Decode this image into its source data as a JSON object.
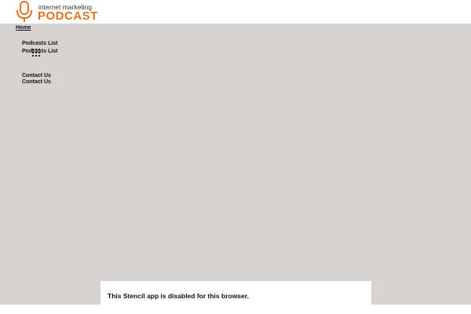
{
  "header": {
    "logo": {
      "line1": "internet marketing",
      "line2": "PODCAST",
      "icon": "microphone-icon",
      "brand_color": "#e0741f"
    }
  },
  "nav": {
    "home": "Home",
    "items": [
      {
        "label": "Podcasts List"
      },
      {
        "label": "Podcasts List"
      },
      {
        "label": "Contact Us"
      },
      {
        "label": "Contact Us"
      }
    ],
    "loading_icon": "loading-dots-icon"
  },
  "notice": {
    "text": "This Stencil app is disabled for this browser."
  },
  "colors": {
    "page_background": "#d8d3d3",
    "header_background": "#ffffff",
    "text": "#111111"
  }
}
